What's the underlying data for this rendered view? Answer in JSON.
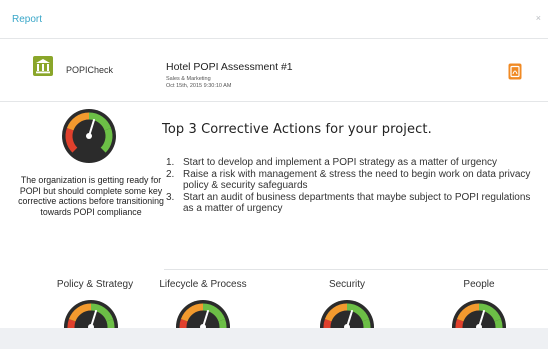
{
  "window": {
    "title": "Report",
    "close_glyph": "×"
  },
  "header": {
    "app_icon": "bank-icon",
    "app_name": "POPICheck",
    "assessment_title": "Hotel POPI Assessment #1",
    "department": "Sales & Marketing",
    "date": "Oct 15th, 2015 9:30:10 AM",
    "export_icon": "pdf-icon"
  },
  "overall": {
    "summary": "The organization is getting ready for POPI but should complete some key corrective actions before transitioning towards POPI compliance"
  },
  "actions": {
    "heading": "Top 3 Corrective Actions for your project.",
    "items": [
      {
        "num": "1.",
        "text": "Start to develop and implement a POPI strategy as a matter of urgency"
      },
      {
        "num": "2.",
        "text": "Raise a risk with management & stress the need to begin work on data privacy policy & security safeguards"
      },
      {
        "num": "3.",
        "text": "Start an audit of business departments that maybe subject to POPI regulations as a matter of urgency"
      }
    ]
  },
  "categories": [
    {
      "label": "Policy & Strategy"
    },
    {
      "label": "Lifecycle & Process"
    },
    {
      "label": "Security"
    },
    {
      "label": "People"
    }
  ],
  "colors": {
    "accent": "#3aa7c9",
    "brand_green": "#8aa62a",
    "pdf_orange": "#f08a24",
    "gauge_red": "#e0402c",
    "gauge_orange": "#f29a2e",
    "gauge_green": "#6cbf46",
    "gauge_dark": "#2b2b2b"
  }
}
